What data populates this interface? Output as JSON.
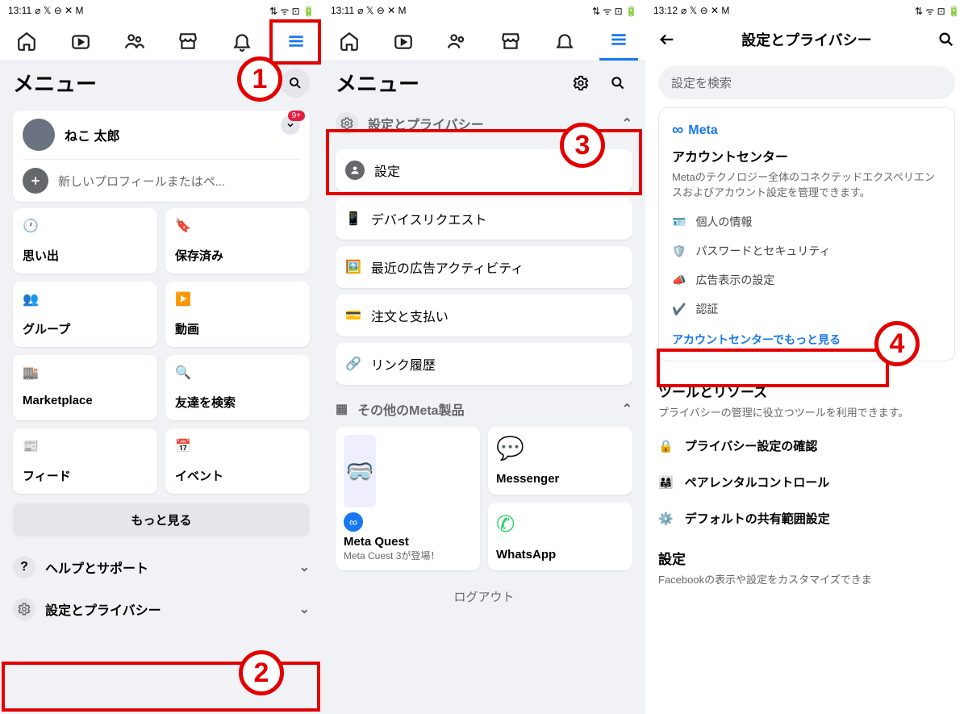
{
  "statusbar": {
    "time1": "13:11",
    "time2": "13:11",
    "time3": "13:12",
    "ind": "⌀ 𝕏 ⊖ ✕ M",
    "right": "⇅ ᯤ ⊡ 🔋"
  },
  "panel1": {
    "title": "メニュー",
    "profile_name": "ねこ 太郎",
    "badge": "9+",
    "add_profile": "新しいプロフィールまたはペ...",
    "shortcuts": [
      {
        "label": "思い出",
        "color": "#1877f2"
      },
      {
        "label": "保存済み",
        "color": "#a030d0"
      },
      {
        "label": "グループ",
        "color": "#1877f2"
      },
      {
        "label": "動画",
        "color": "#1877f2"
      },
      {
        "label": "Marketplace",
        "color": "#1877f2"
      },
      {
        "label": "友達を検索",
        "color": "#1c1e21"
      },
      {
        "label": "フィード",
        "color": "#1877f2"
      },
      {
        "label": "イベント",
        "color": "#e41e3f"
      }
    ],
    "more": "もっと見る",
    "help": "ヘルプとサポート",
    "settings": "設定とプライバシー"
  },
  "panel2": {
    "title": "メニュー",
    "section": "設定とプライバシー",
    "items": [
      "設定",
      "デバイスリクエスト",
      "最近の広告アクティビティ",
      "注文と支払い",
      "リンク履歴"
    ],
    "meta_section": "その他のMeta製品",
    "meta_products": [
      {
        "title": "Meta Quest",
        "sub": "Meta Cuest 3が登場！"
      },
      {
        "title": "Messenger",
        "sub": ""
      },
      {
        "title": "WhatsApp",
        "sub": ""
      }
    ],
    "logout": "ログアウト"
  },
  "panel3": {
    "title": "設定とプライバシー",
    "search_placeholder": "設定を検索",
    "meta": "Meta",
    "account_center": "アカウントセンター",
    "account_desc": "Metaのテクノロジー全体のコネクテッドエクスペリエンスおよびアカウント設定を管理できます。",
    "items": [
      "個人の情報",
      "パスワードとセキュリティ",
      "広告表示の設定",
      "認証"
    ],
    "more_link": "アカウントセンターでもっと見る",
    "tools_title": "ツールとリソース",
    "tools_desc": "プライバシーの管理に役立つツールを利用できます。",
    "tools": [
      "プライバシー設定の確認",
      "ペアレンタルコントロール",
      "デフォルトの共有範囲設定"
    ],
    "settings_title": "設定",
    "settings_desc": "Facebookの表示や設定をカスタマイズできま"
  },
  "annotations": {
    "n1": "1",
    "n2": "2",
    "n3": "3",
    "n4": "4"
  }
}
